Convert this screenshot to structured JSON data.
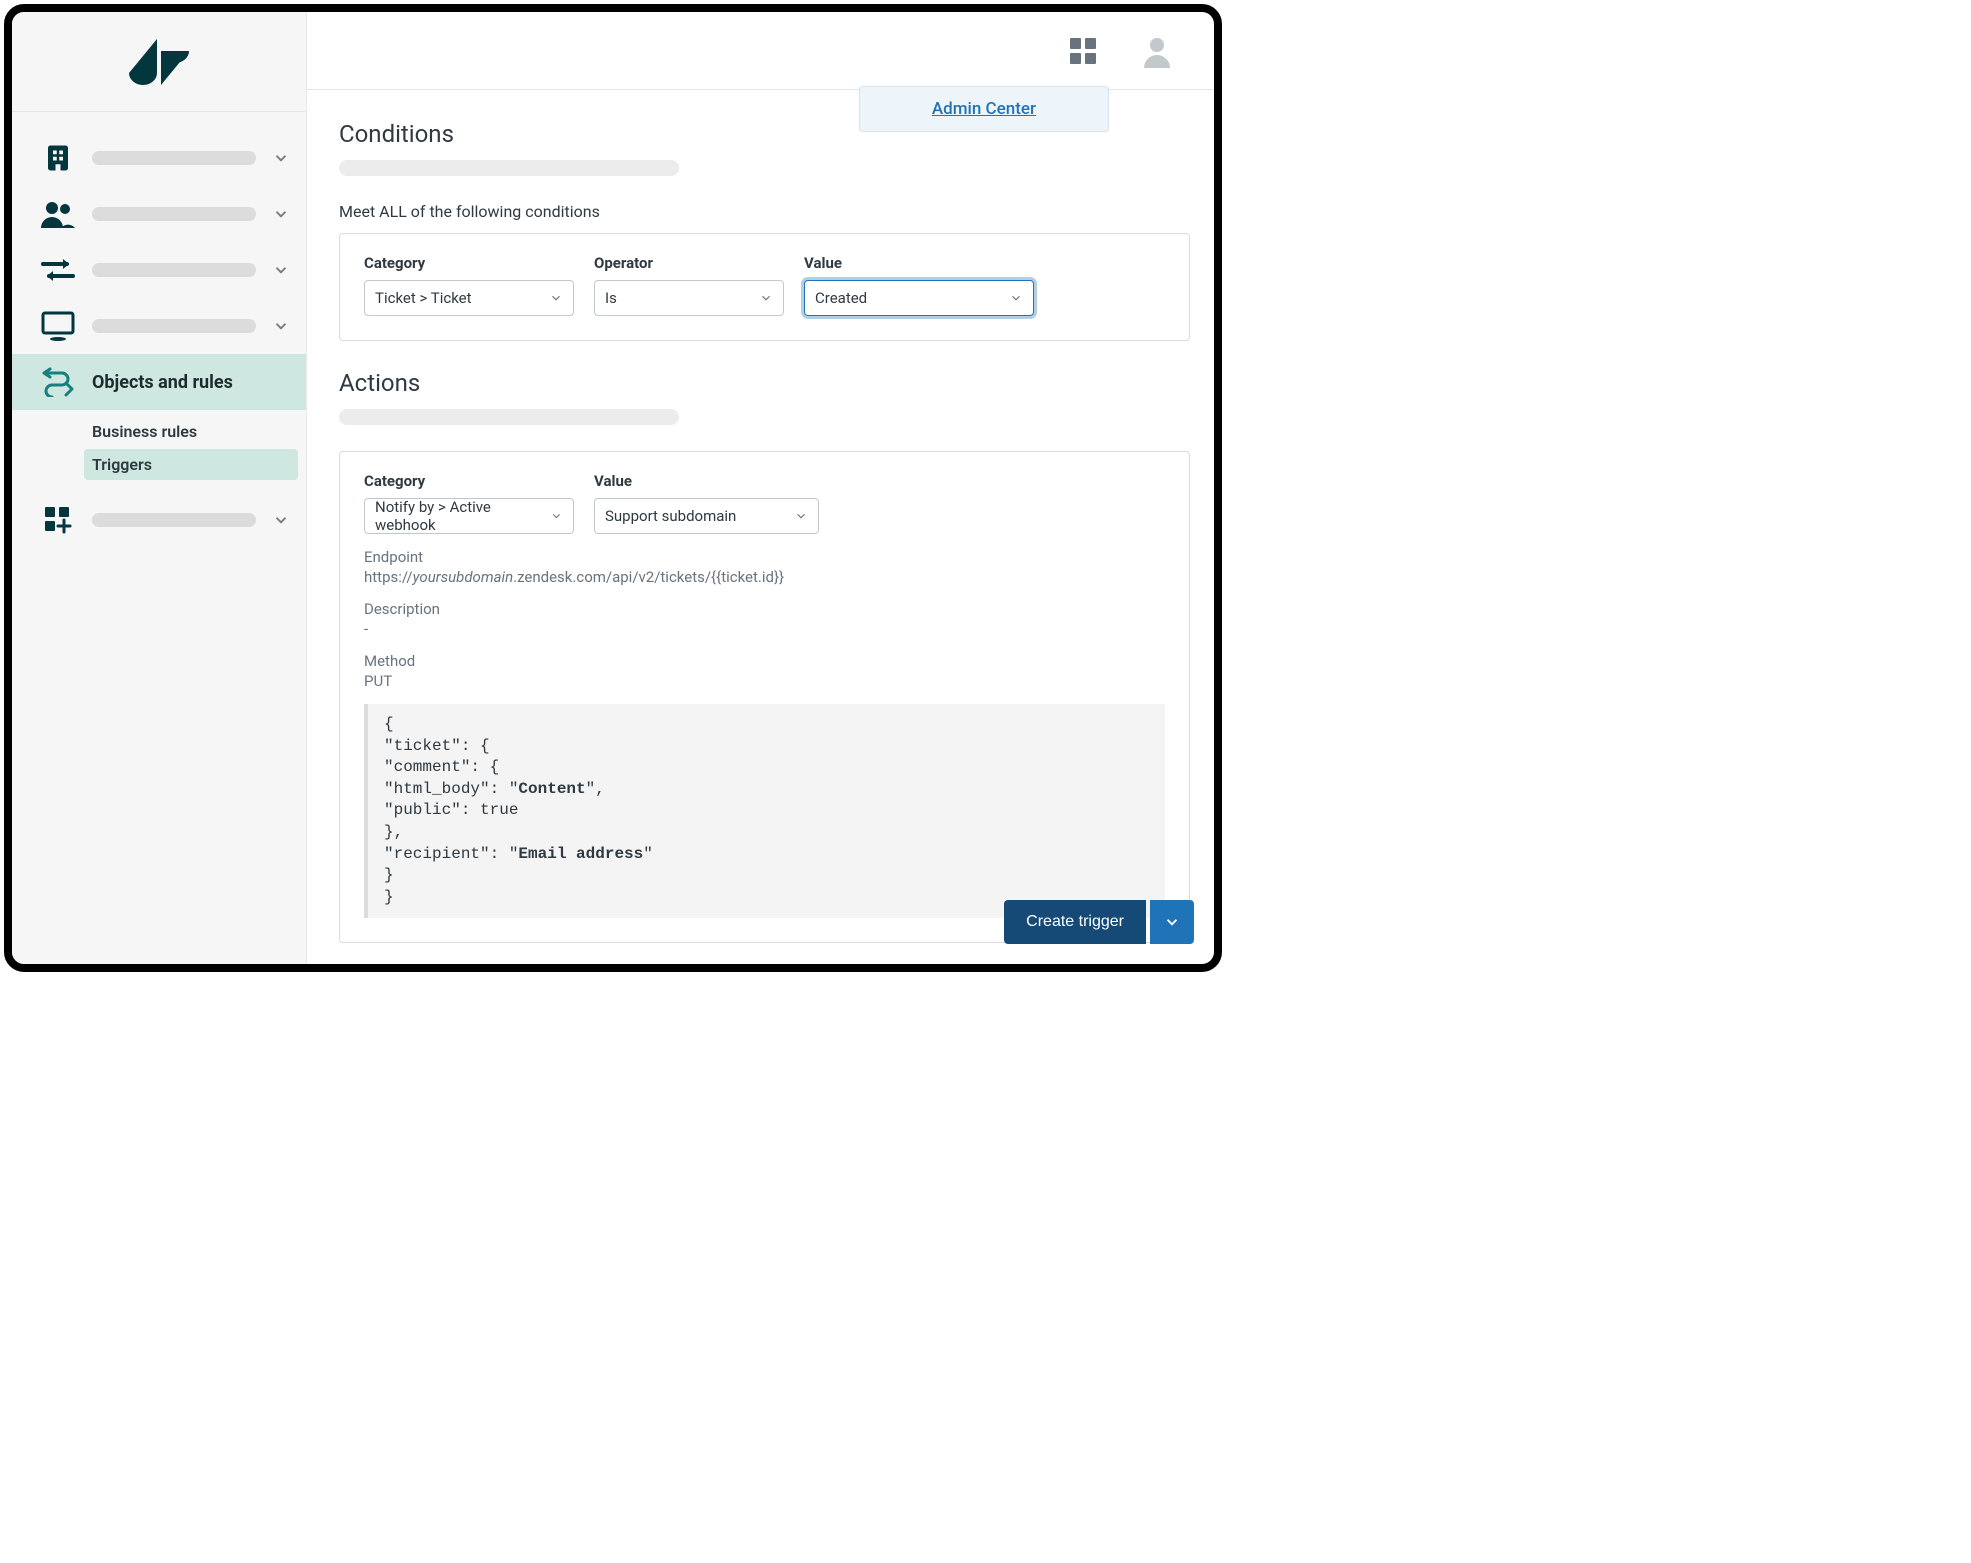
{
  "header": {
    "admin_center": "Admin Center"
  },
  "sidebar": {
    "objects_and_rules": "Objects and rules",
    "business_rules": "Business rules",
    "triggers": "Triggers"
  },
  "conditions": {
    "title": "Conditions",
    "meet_all": "Meet ALL of the following conditions",
    "category_label": "Category",
    "operator_label": "Operator",
    "value_label": "Value",
    "category_value": "Ticket > Ticket",
    "operator_value": "Is",
    "value_value": "Created"
  },
  "actions": {
    "title": "Actions",
    "category_label": "Category",
    "value_label": "Value",
    "category_value": "Notify by > Active webhook",
    "value_value": "Support subdomain",
    "endpoint_label": "Endpoint",
    "endpoint_prefix": "https://",
    "endpoint_sub": "yoursubdomain",
    "endpoint_rest": ".zendesk.com/api/v2/tickets/{{ticket.id}}",
    "description_label": "Description",
    "description_value": "-",
    "method_label": "Method",
    "method_value": "PUT",
    "code_l1": "{",
    "code_l2": "\"ticket\": {",
    "code_l3": "\"comment\": {",
    "code_l4a": "\"html_body\": \"",
    "code_l4b": "Content",
    "code_l4c": "\",",
    "code_l5": "\"public\": true",
    "code_l6": "},",
    "code_l7a": "\"recipient\": \"",
    "code_l7b": "Email address",
    "code_l7c": "\"",
    "code_l8": "}",
    "code_l9": "}"
  },
  "footer": {
    "create_trigger": "Create trigger"
  }
}
